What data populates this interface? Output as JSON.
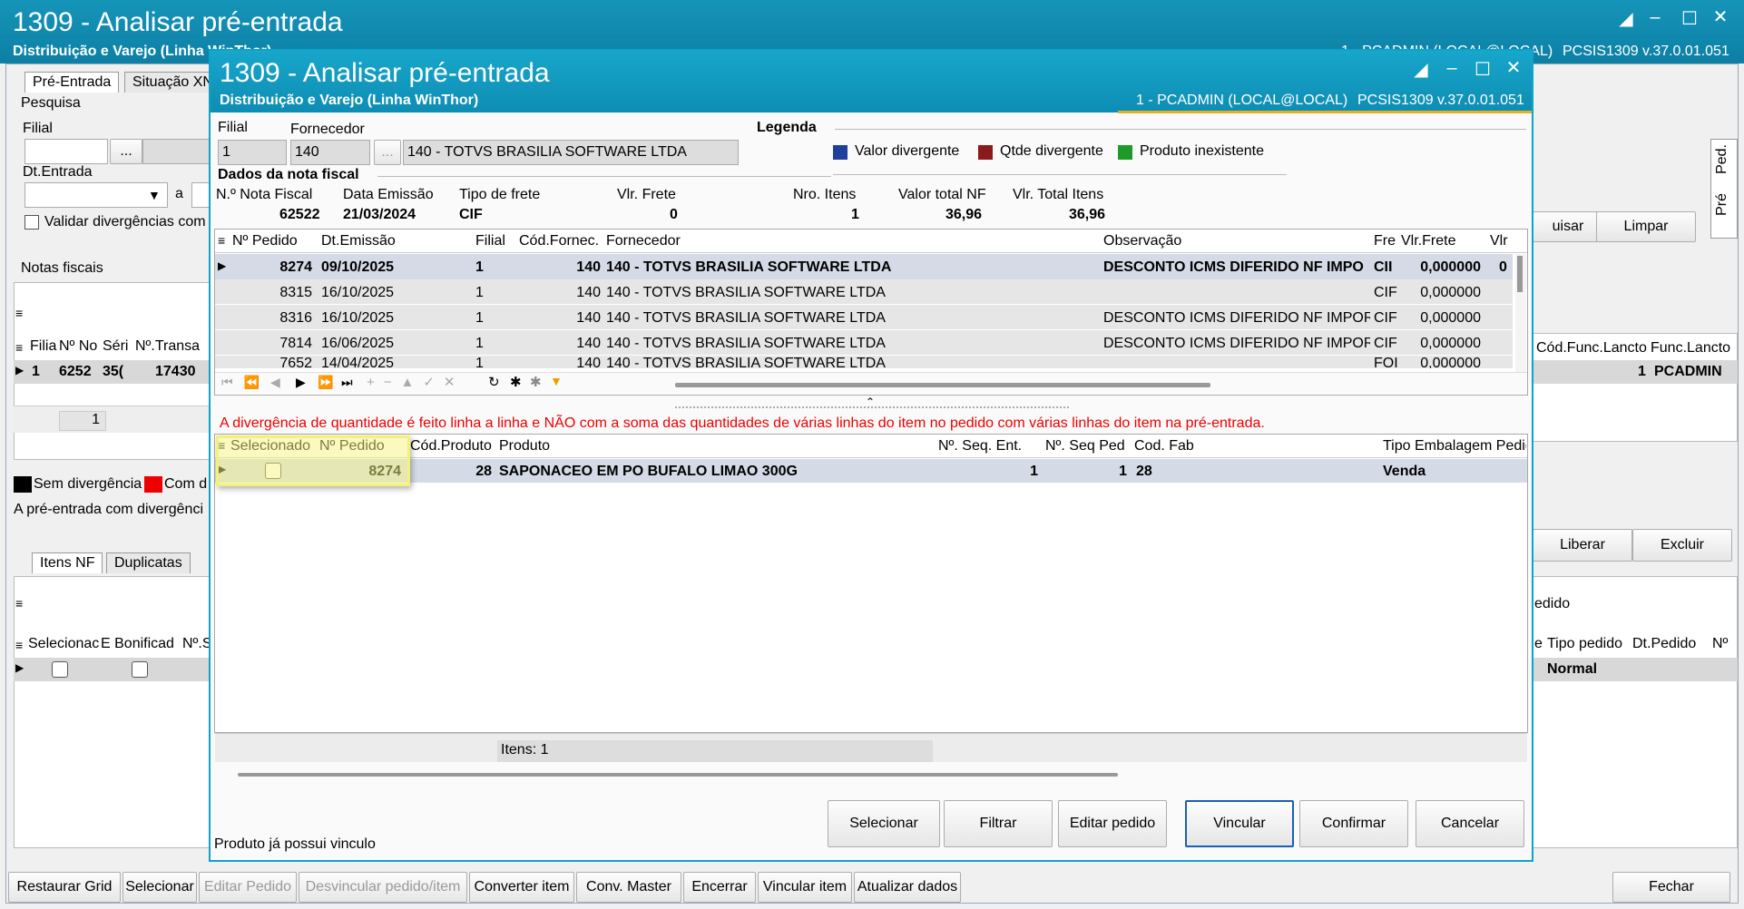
{
  "main_window": {
    "title": "1309 - Analisar pré-entrada",
    "subtitle": "Distribuição e Varejo (Linha WinThor)",
    "user_info": "1 - PCADMIN (LOCAL@LOCAL)",
    "version": "PCSIS1309 v.37.0.01.051",
    "tabs": [
      "Pré-Entrada",
      "Situação XN"
    ],
    "pesquisa_label": "Pesquisa",
    "filial_label": "Filial",
    "ellipsis": "...",
    "dt_entrada_label": "Dt.Entrada",
    "a_label": "a",
    "validar_label": "Validar divergências com",
    "notas_label": "Notas fiscais",
    "notas_columns": [
      "Filia",
      "Nº No",
      "Séri",
      "Nº.Transa"
    ],
    "notas_row": [
      "1",
      "6252",
      "35(",
      "17430"
    ],
    "right_columns": [
      "Cód.Func.Lancto",
      "Func.Lancto"
    ],
    "right_row": [
      "1",
      "PCADMIN"
    ],
    "pager_value": "1",
    "legend_sem": "Sem divergência",
    "legend_com": "Com d",
    "info_text": "A pré-entrada com divergênci",
    "lower_tabs": [
      "Itens NF",
      "Duplicatas"
    ],
    "items_columns": [
      "Selecionac",
      "E Bonificad",
      "Nº.S"
    ],
    "right_lower_title": "edido",
    "right_lower_columns": [
      "e",
      "Tipo pedido",
      "Dt.Pedido",
      "Nº"
    ],
    "right_lower_row": "Normal",
    "side_tabs": [
      "Ped.",
      "Pré"
    ],
    "right_buttons": {
      "pesquisar": "uisar",
      "limpar": "Limpar",
      "liberar": "Liberar",
      "excluir": "Excluir"
    },
    "bottom_buttons": [
      {
        "label": "Restaurar Grid",
        "enabled": true
      },
      {
        "label": "Selecionar",
        "enabled": true
      },
      {
        "label": "Editar Pedido",
        "enabled": false
      },
      {
        "label": "Desvincular pedido/item",
        "enabled": false
      },
      {
        "label": "Converter item",
        "enabled": true
      },
      {
        "label": "Conv. Master",
        "enabled": true
      },
      {
        "label": "Encerrar",
        "enabled": true
      },
      {
        "label": "Vincular item",
        "enabled": true
      },
      {
        "label": "Atualizar dados",
        "enabled": true
      }
    ],
    "fechar": "Fechar"
  },
  "dialog": {
    "title": "1309 - Analisar pré-entrada",
    "subtitle": "Distribuição e Varejo (Linha WinThor)",
    "user_info": "1 - PCADMIN (LOCAL@LOCAL)",
    "version": "PCSIS1309  v.37.0.01.051",
    "filial_label": "Filial",
    "filial_value": "1",
    "fornecedor_label": "Fornecedor",
    "fornecedor_code": "140",
    "ellipsis": "...",
    "fornecedor_name": "140 - TOTVS BRASILIA SOFTWARE LTDA",
    "legenda_title": "Legenda",
    "legend": [
      {
        "label": "Valor divergente",
        "color": "#1f3f9a"
      },
      {
        "label": "Qtde divergente",
        "color": "#8b1a1a"
      },
      {
        "label": "Produto inexistente",
        "color": "#1f9a2a"
      }
    ],
    "nf_section": "Dados da nota fiscal",
    "nf_fields": [
      {
        "label": "N.º Nota Fiscal",
        "value": "62522"
      },
      {
        "label": "Data Emissão",
        "value": "21/03/2024"
      },
      {
        "label": "Tipo de frete",
        "value": "CIF"
      },
      {
        "label": "Vlr. Frete",
        "value": "0"
      },
      {
        "label": "Nro. Itens",
        "value": "1"
      },
      {
        "label": "Valor total NF",
        "value": "36,96"
      },
      {
        "label": "Vlr. Total Itens",
        "value": "36,96"
      }
    ],
    "orders_columns": [
      "Nº Pedido",
      "Dt.Emissão",
      "Filial",
      "Cód.Fornec.",
      "Fornecedor",
      "Observação",
      "Fre",
      "Vlr.Frete",
      "Vlr"
    ],
    "orders_rows": [
      [
        "8274",
        "09/10/2025",
        "1",
        "140",
        "140 - TOTVS BRASILIA SOFTWARE LTDA",
        "DESCONTO ICMS DIFERIDO NF IMPO",
        "CII",
        "0,000000",
        "0"
      ],
      [
        "8315",
        "16/10/2025",
        "1",
        "140",
        "140 - TOTVS BRASILIA SOFTWARE LTDA",
        "",
        "CIF",
        "0,000000",
        ""
      ],
      [
        "8316",
        "16/10/2025",
        "1",
        "140",
        "140 - TOTVS BRASILIA SOFTWARE LTDA",
        "DESCONTO ICMS DIFERIDO NF IMPORT/",
        "CIF",
        "0,000000",
        ""
      ],
      [
        "7814",
        "16/06/2025",
        "1",
        "140",
        "140 - TOTVS BRASILIA SOFTWARE LTDA",
        "DESCONTO ICMS DIFERIDO NF IMPORT/",
        "CIF",
        "0,000000",
        ""
      ],
      [
        "7652",
        "14/04/2025",
        "1",
        "140",
        "140 - TOTVS BRASILIA SOFTWARE LTDA",
        "",
        "FOI",
        "0,000000",
        ""
      ]
    ],
    "warning": "A divergência de quantidade é feito linha a linha e NÃO com a soma das quantidades de várias linhas do item no pedido com várias linhas do item na pré-entrada.",
    "items_columns": [
      "Selecionado",
      "Nº Pedido",
      "Cód.Produto",
      "Produto",
      "Nº. Seq. Ent.",
      "Nº. Seq Ped",
      "Cod. Fab",
      "Tipo Embalagem Pedid"
    ],
    "items_row": [
      "",
      "8274",
      "28",
      "SAPONACEO EM PO BUFALO LIMAO 300G",
      "1",
      "1",
      "28",
      "Venda"
    ],
    "items_footer": "Itens: 1",
    "status_text": "Produto já possui vinculo",
    "buttons": [
      "Selecionar",
      "Filtrar",
      "Editar pedido",
      "Vincular",
      "Confirmar",
      "Cancelar"
    ]
  }
}
